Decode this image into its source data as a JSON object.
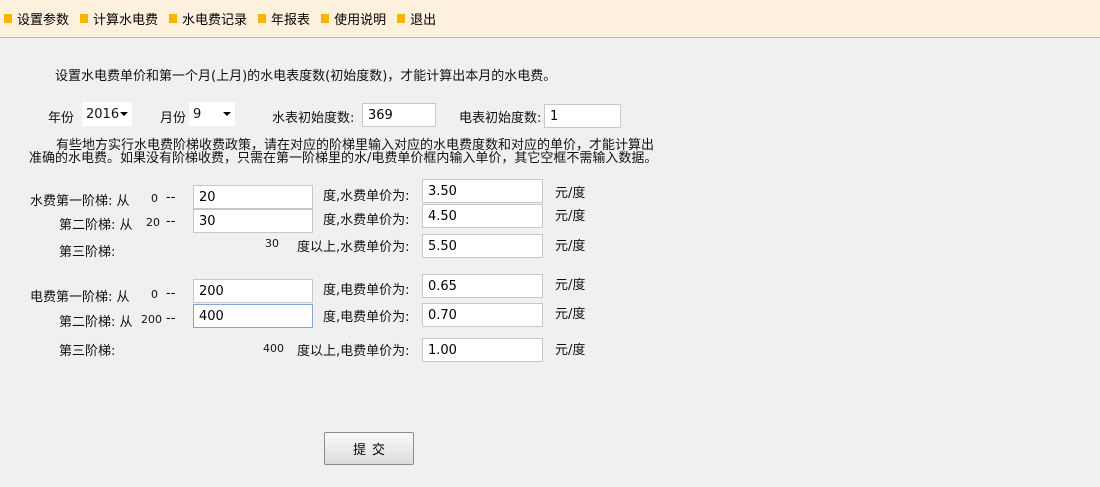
{
  "menu": [
    {
      "label": "设置参数"
    },
    {
      "label": "计算水电费"
    },
    {
      "label": "水电费记录"
    },
    {
      "label": "年报表"
    },
    {
      "label": "使用说明"
    },
    {
      "label": "退出"
    }
  ],
  "colors": {
    "menu_bullet": "#f7b500",
    "menu_bg": "#fdf0dc"
  },
  "intro": "设置水电费单价和第一个月(上月)的水电表度数(初始度数)，才能计算出本月的水电费。",
  "params": {
    "year_label": "年份",
    "year_value": "2016",
    "month_label": "月份",
    "month_value": "9",
    "water_init_label": "水表初始度数:",
    "water_init_value": "369",
    "elec_init_label": "电表初始度数:",
    "elec_init_value": "1"
  },
  "note_line1": "有些地方实行水电费阶梯收费政策，请在对应的阶梯里输入对应的水电费度数和对应的单价，才能计算出",
  "note_line2": "准确的水电费。如果没有阶梯收费，只需在第一阶梯里的水/电费单价框内输入单价，其它空框不需输入数据。",
  "water": {
    "tier1_label": "水费第一阶梯: 从",
    "tier1_from": "0",
    "tier1_to": "20",
    "tier1_price_label": "度,水费单价为:",
    "tier1_price": "3.50",
    "tier2_label": "第二阶梯: 从",
    "tier2_from": "20",
    "tier2_to": "30",
    "tier2_price_label": "度,水费单价为:",
    "tier2_price": "4.50",
    "tier3_label": "第三阶梯:",
    "tier3_from": "30",
    "tier3_price_label": "度以上,水费单价为:",
    "tier3_price": "5.50",
    "dash": "--",
    "unit": "元/度"
  },
  "elec": {
    "tier1_label": "电费第一阶梯: 从",
    "tier1_from": "0",
    "tier1_to": "200",
    "tier1_price_label": "度,电费单价为:",
    "tier1_price": "0.65",
    "tier2_label": "第二阶梯: 从",
    "tier2_from": "200",
    "tier2_to": "400",
    "tier2_price_label": "度,电费单价为:",
    "tier2_price": "0.70",
    "tier3_label": "第三阶梯:",
    "tier3_from": "400",
    "tier3_price_label": "度以上,电费单价为:",
    "tier3_price": "1.00",
    "dash": "--",
    "unit": "元/度"
  },
  "submit_label": "提交"
}
